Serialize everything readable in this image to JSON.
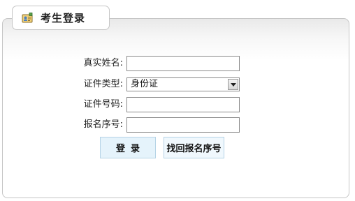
{
  "title": "考生登录",
  "icons": {
    "title_icon": "id-card-icon",
    "select_arrow": "chevron-down-icon"
  },
  "form": {
    "name_label": "真实姓名:",
    "name_value": "",
    "id_type_label": "证件类型:",
    "id_type_value": "身份证",
    "id_number_label": "证件号码:",
    "id_number_value": "",
    "reg_number_label": "报名序号:",
    "reg_number_value": ""
  },
  "buttons": {
    "login": "登录",
    "recover": "找回报名序号"
  },
  "colors": {
    "button_bg": "#e5f3fb",
    "button_border": "#b5d3e6",
    "panel_border": "#c6c6c6"
  }
}
